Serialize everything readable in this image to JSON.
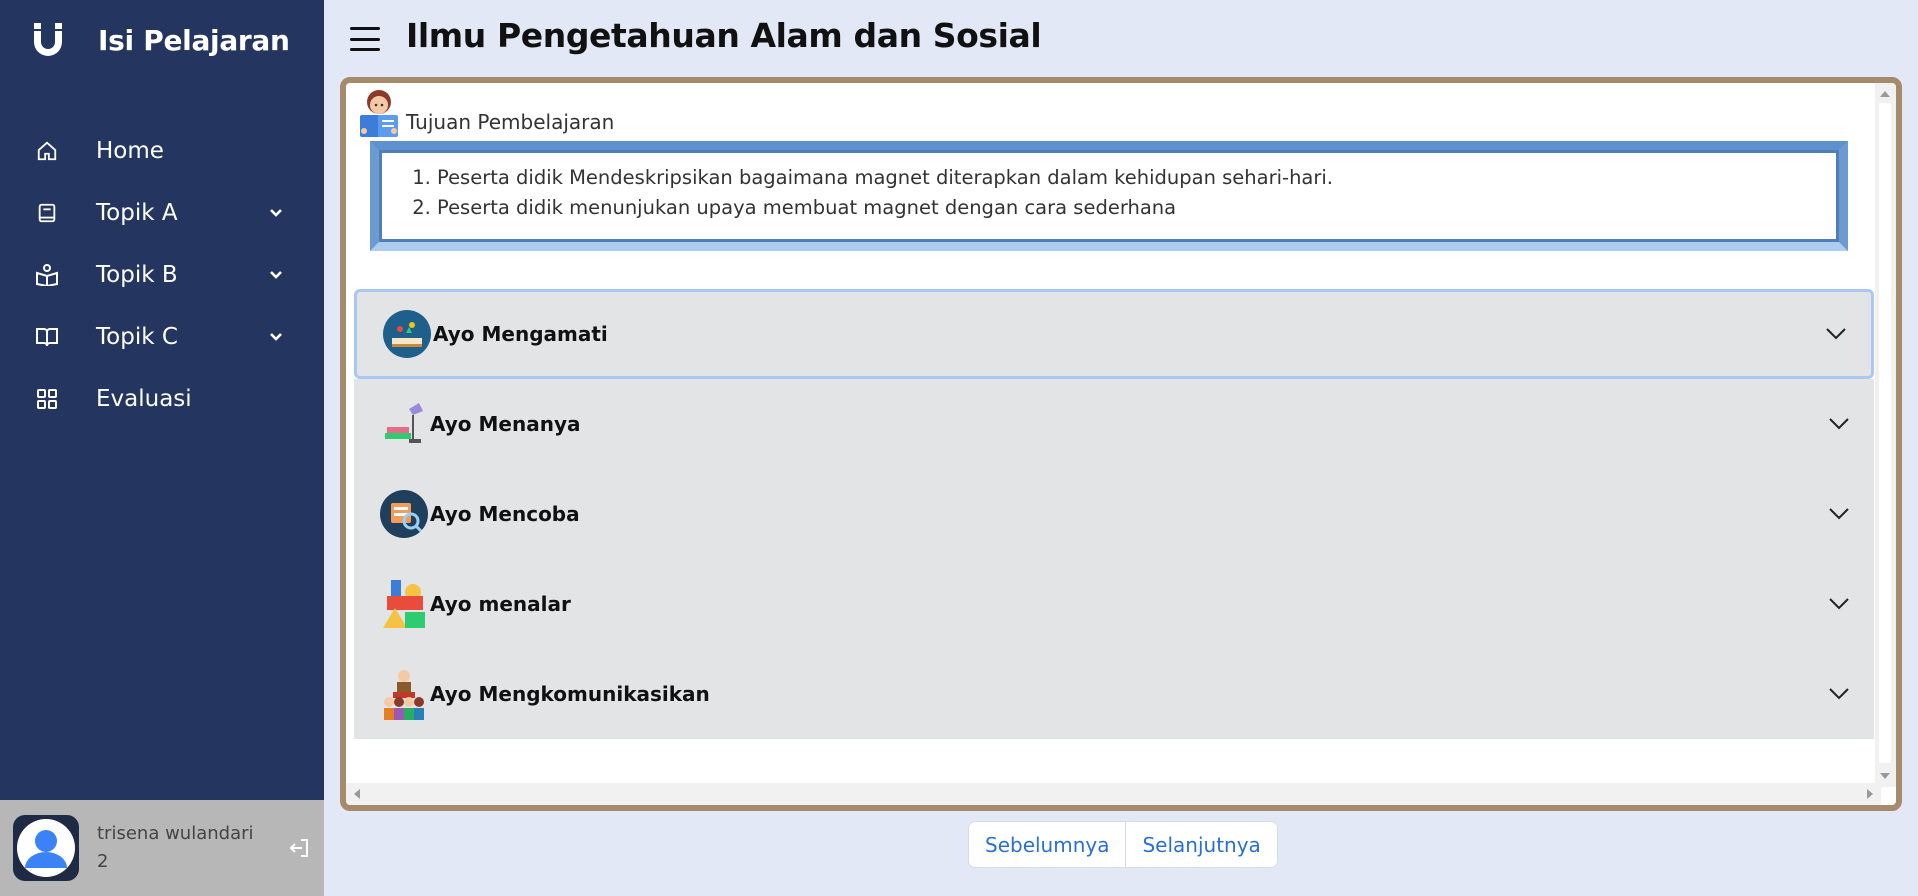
{
  "sidebar": {
    "brand_title": "Isi Pelajaran",
    "items": [
      {
        "label": "Home",
        "icon": "home-icon"
      },
      {
        "label": "Topik A",
        "icon": "book-icon"
      },
      {
        "label": "Topik B",
        "icon": "reader-icon"
      },
      {
        "label": "Topik C",
        "icon": "open-book-icon"
      },
      {
        "label": "Evaluasi",
        "icon": "grid-icon"
      }
    ],
    "user": {
      "name": "trisena wulandari",
      "number": "2"
    }
  },
  "header": {
    "title": "Ilmu Pengetahuan Alam dan Sosial"
  },
  "goals": {
    "label": "Tujuan Pembelajaran",
    "items": [
      "Peserta didik Mendeskripsikan bagaimana magnet diterapkan dalam kehidupan sehari-hari.",
      "Peserta didik menunjukan upaya membuat magnet dengan cara sederhana"
    ]
  },
  "accordion": [
    {
      "title": "Ayo Mengamati",
      "icon": "observe-icon"
    },
    {
      "title": "Ayo Menanya",
      "icon": "question-icon"
    },
    {
      "title": "Ayo Mencoba",
      "icon": "experiment-icon"
    },
    {
      "title": "Ayo menalar",
      "icon": "reasoning-icon"
    },
    {
      "title": "Ayo Mengkomunikasikan",
      "icon": "communicate-icon"
    }
  ],
  "pager": {
    "prev": "Sebelumnya",
    "next": "Selanjutnya"
  },
  "colors": {
    "sidebar": "#24355f",
    "accent": "#2a6fd4",
    "frame_border": "#a58a6c",
    "accordion_bg": "#e3e4e6"
  }
}
